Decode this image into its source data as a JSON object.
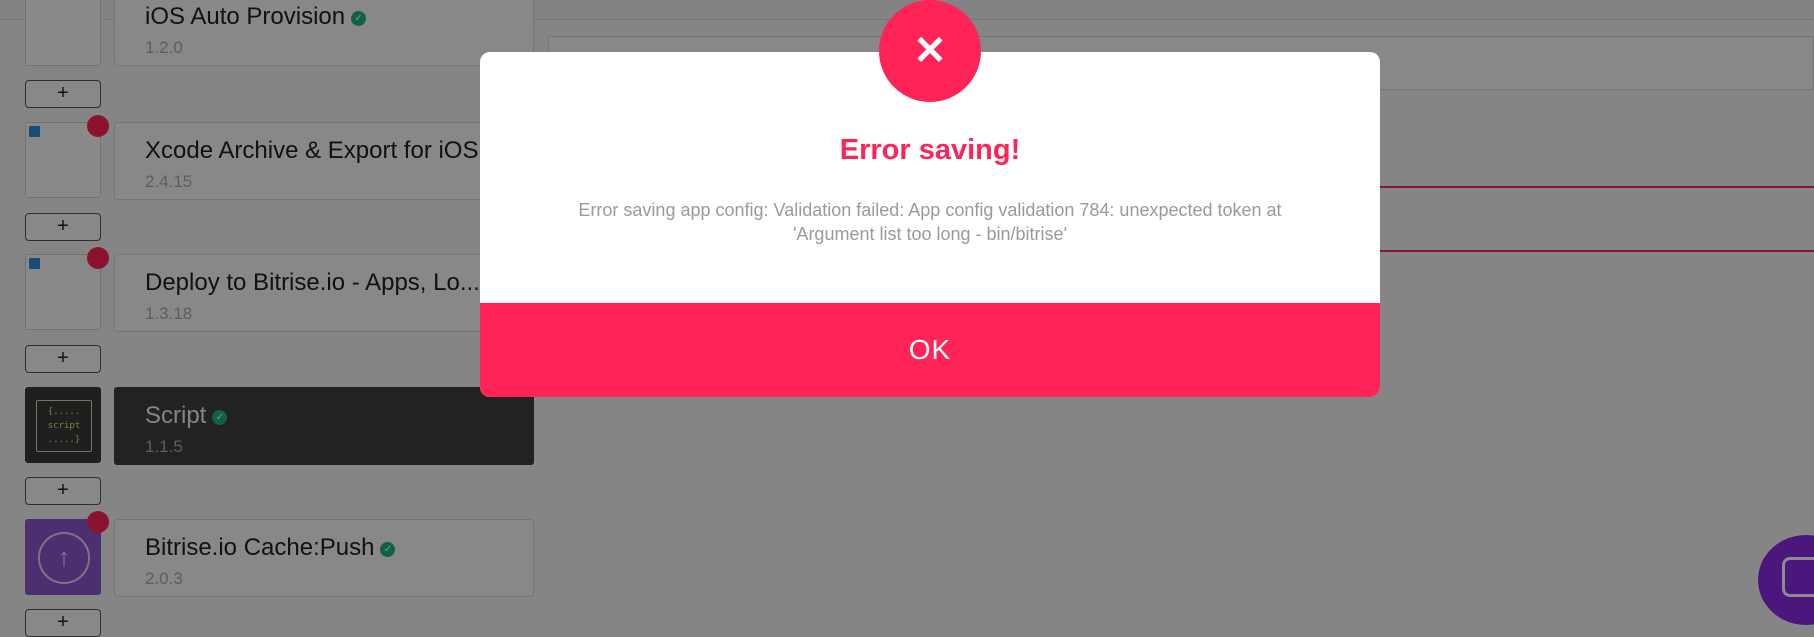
{
  "workflow": {
    "add_label": "+",
    "steps": [
      {
        "title": "iOS Auto Provision",
        "version": "1.2.0",
        "verified": true
      },
      {
        "title": "Xcode Archive & Export for iOS",
        "version": "2.4.15",
        "verified": false
      },
      {
        "title": "Deploy to Bitrise.io - Apps, Lo...",
        "version": "1.3.18",
        "verified": false
      },
      {
        "title": "Script",
        "version": "1.1.5",
        "verified": true,
        "icon_text": "{.....\nscript\n.....}"
      },
      {
        "title": "Bitrise.io Cache:Push",
        "version": "2.0.3",
        "verified": true
      }
    ]
  },
  "modal": {
    "icon": "close-icon",
    "icon_glyph": "✕",
    "title": "Error saving!",
    "message": "Error saving app config: Validation failed: App config validation 784: unexpected token at 'Argument list too long - bin/bitrise'",
    "ok_label": "OK"
  },
  "colors": {
    "accent": "#ff2458",
    "verified": "#1fb185",
    "chat": "#8a2be2"
  },
  "chat": {
    "icon": "chat-icon"
  }
}
